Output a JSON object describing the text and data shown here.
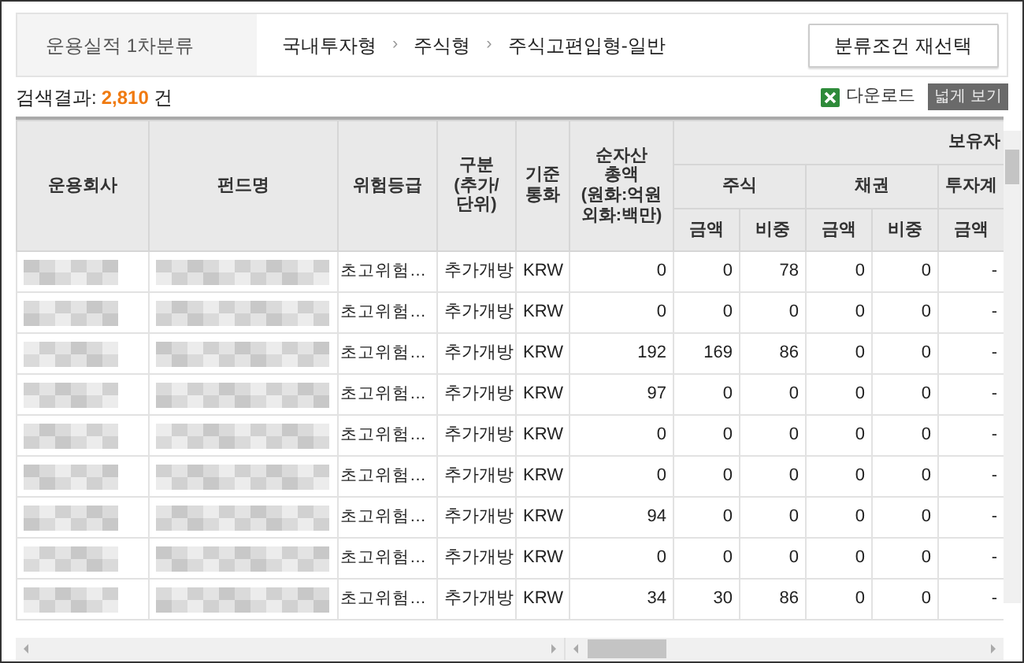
{
  "top_bar": {
    "category_label": "운용실적 1차분류",
    "breadcrumb": [
      {
        "kind": "item",
        "text": "국내투자형"
      },
      {
        "kind": "separator",
        "text": "›"
      },
      {
        "kind": "item",
        "text": "주식형"
      },
      {
        "kind": "separator",
        "text": "›"
      },
      {
        "kind": "item",
        "text": "주식고편입형-일반"
      }
    ],
    "reselect_button": "분류조건 재선택"
  },
  "result": {
    "label": "검색결과:",
    "count": "2,810",
    "unit": "건"
  },
  "tools": {
    "download": "다운로드",
    "wide_view": "넓게 보기"
  },
  "table": {
    "columns": [
      "운용회사",
      "펀드명",
      "위험등급",
      "구분\n(추가/\n단위)",
      "기준\n통화",
      "순자산\n총액\n(원화:억원\n외화:백만)"
    ],
    "group": "보유자",
    "subgroups": [
      {
        "label": "주식",
        "subcolumns": [
          "금액",
          "비중"
        ]
      },
      {
        "label": "채권",
        "subcolumns": [
          "금액",
          "비중"
        ]
      },
      {
        "label": "투자계",
        "subcolumns": [
          "금액"
        ]
      }
    ],
    "rows": [
      {
        "company_blurred": true,
        "fund_blurred": true,
        "cells": [
          "",
          "",
          "초고위험…",
          "추가개방",
          "KRW",
          "0",
          "0",
          "78",
          "0",
          "0",
          "-"
        ]
      },
      {
        "company_blurred": true,
        "fund_blurred": true,
        "cells": [
          "",
          "",
          "초고위험…",
          "추가개방",
          "KRW",
          "0",
          "0",
          "0",
          "0",
          "0",
          "-"
        ]
      },
      {
        "company_blurred": true,
        "fund_blurred": true,
        "cells": [
          "",
          "",
          "초고위험…",
          "추가개방",
          "KRW",
          "192",
          "169",
          "86",
          "0",
          "0",
          "-"
        ]
      },
      {
        "company_blurred": true,
        "fund_blurred": true,
        "cells": [
          "",
          "",
          "초고위험…",
          "추가개방",
          "KRW",
          "97",
          "0",
          "0",
          "0",
          "0",
          "-"
        ]
      },
      {
        "company_blurred": true,
        "fund_blurred": true,
        "cells": [
          "",
          "",
          "초고위험…",
          "추가개방",
          "KRW",
          "0",
          "0",
          "0",
          "0",
          "0",
          "-"
        ]
      },
      {
        "company_blurred": true,
        "fund_blurred": true,
        "cells": [
          "",
          "",
          "초고위험…",
          "추가개방",
          "KRW",
          "0",
          "0",
          "0",
          "0",
          "0",
          "-"
        ]
      },
      {
        "company_blurred": true,
        "fund_blurred": true,
        "cells": [
          "",
          "",
          "초고위험…",
          "추가개방",
          "KRW",
          "94",
          "0",
          "0",
          "0",
          "0",
          "-"
        ]
      },
      {
        "company_blurred": true,
        "fund_blurred": true,
        "cells": [
          "",
          "",
          "초고위험…",
          "추가개방",
          "KRW",
          "0",
          "0",
          "0",
          "0",
          "0",
          "-"
        ]
      },
      {
        "company_blurred": true,
        "fund_blurred": true,
        "cells": [
          "",
          "",
          "초고위험…",
          "추가개방",
          "KRW",
          "34",
          "30",
          "86",
          "0",
          "0",
          "-"
        ]
      }
    ]
  }
}
